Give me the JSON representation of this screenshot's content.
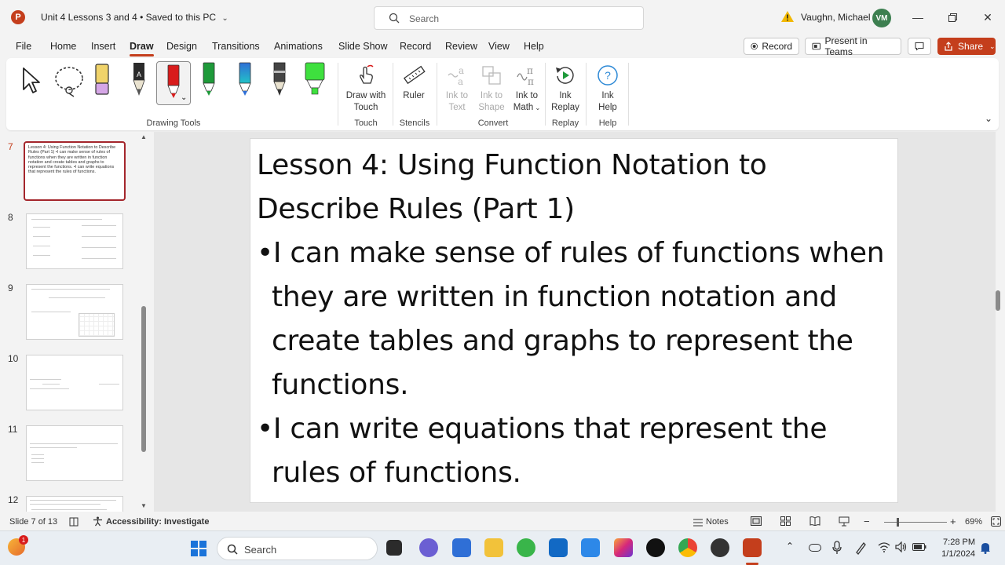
{
  "titlebar": {
    "doc_title": "Unit 4 Lessons 3 and 4",
    "saved_status": "• Saved to this PC",
    "search_placeholder": "Search",
    "user_name": "Vaughn, Michael",
    "user_initials": "VM"
  },
  "menu": {
    "tabs": [
      "File",
      "Home",
      "Insert",
      "Draw",
      "Design",
      "Transitions",
      "Animations",
      "Slide Show",
      "Record",
      "Review",
      "View",
      "Help"
    ],
    "active_tab": "Draw",
    "record_label": "Record",
    "present_label": "Present in Teams",
    "share_label": "Share"
  },
  "ribbon": {
    "groups": {
      "drawing_tools": "Drawing Tools",
      "touch": "Touch",
      "stencils": "Stencils",
      "convert": "Convert",
      "replay": "Replay",
      "help": "Help"
    },
    "buttons": {
      "draw_with_touch_1": "Draw with",
      "draw_with_touch_2": "Touch",
      "ruler": "Ruler",
      "ink_to_text_1": "Ink to",
      "ink_to_text_2": "Text",
      "ink_to_shape_1": "Ink to",
      "ink_to_shape_2": "Shape",
      "ink_to_math_1": "Ink to",
      "ink_to_math_2": "Math",
      "ink_replay_1": "Ink",
      "ink_replay_2": "Replay",
      "ink_help_1": "Ink",
      "ink_help_2": "Help"
    },
    "pen_colors": [
      "#e8c84a",
      "#222222",
      "#d81c1c",
      "#1e9a3a",
      "#2f6fd6",
      "#333333",
      "#3ee03e"
    ]
  },
  "thumbnails": {
    "numbers": [
      "7",
      "8",
      "9",
      "10",
      "11",
      "12"
    ],
    "active": "7",
    "slide7_text": "Lesson 4: Using Function Notation to Describe Rules (Part 1) •I can make sense of rules of functions when they are written in function notation and create tables and graphs to represent the functions. •I can write equations that represent the rules of functions."
  },
  "slide": {
    "title": "Lesson 4: Using Function Notation to Describe Rules (Part 1)",
    "bullets": [
      "•I can make sense of rules of functions when they are written in function notation and create tables and graphs to represent the functions.",
      "•I can write equations that represent the rules of functions."
    ]
  },
  "statusbar": {
    "slide_counter": "Slide 7 of 13",
    "accessibility": "Accessibility: Investigate",
    "notes_label": "Notes",
    "zoom": "69%"
  },
  "taskbar": {
    "search_placeholder": "Search",
    "time": "7:28 PM",
    "date": "1/1/2024"
  }
}
